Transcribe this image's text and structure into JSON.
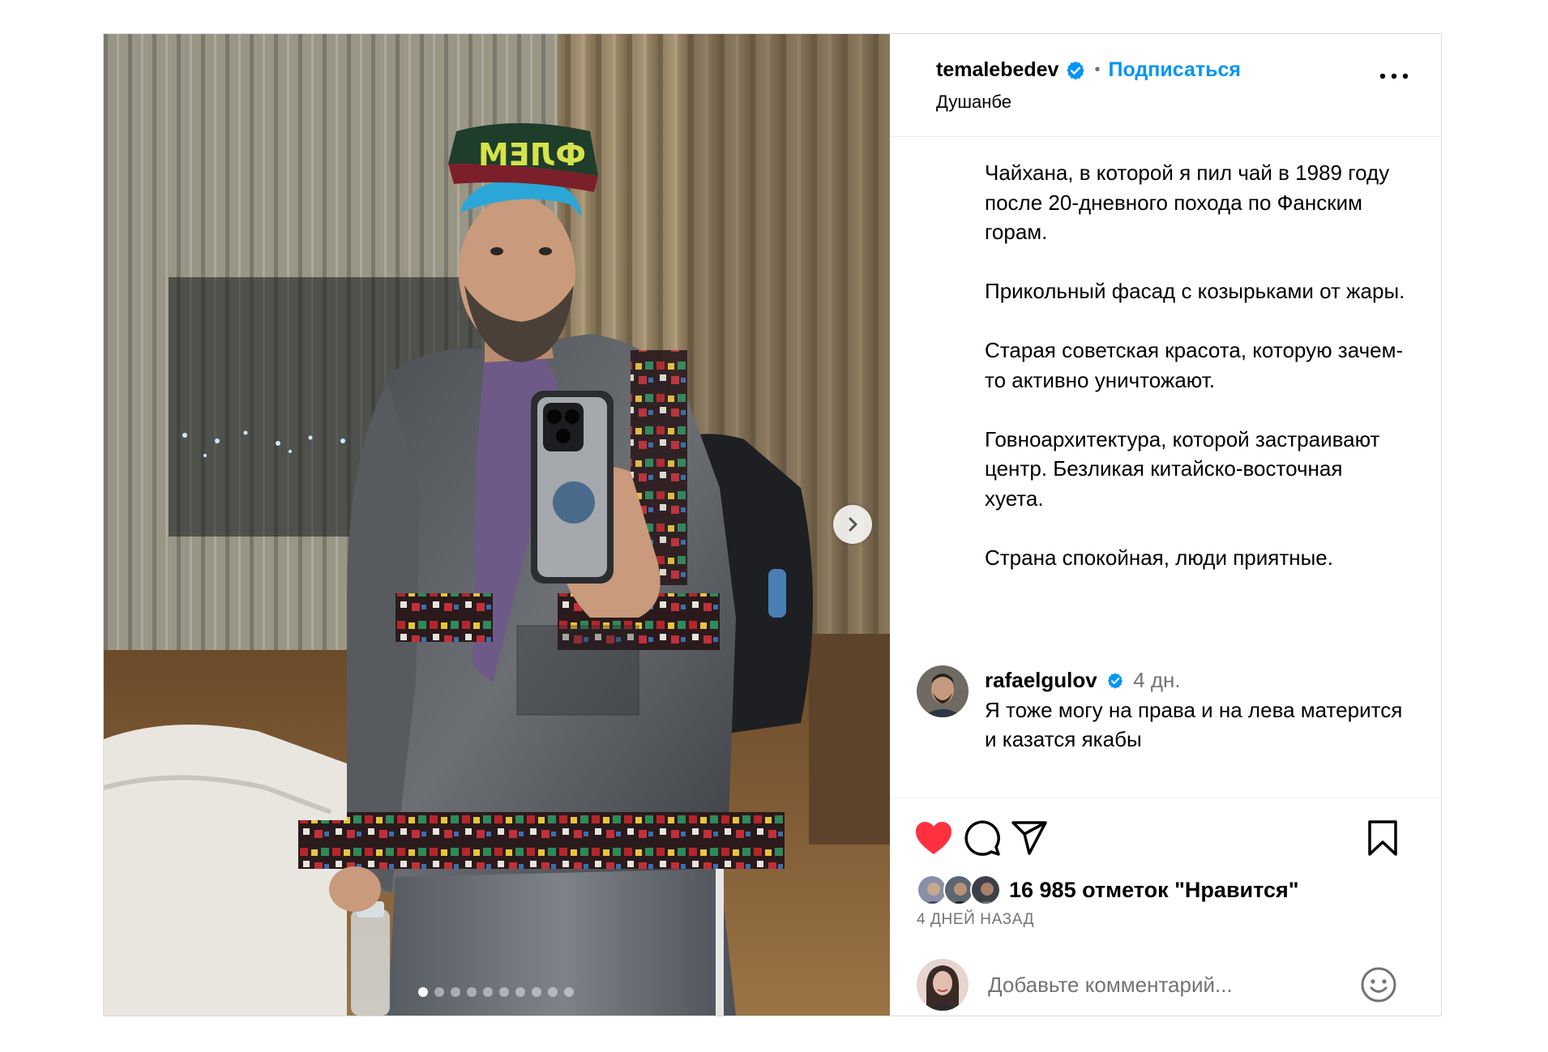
{
  "post": {
    "username": "temalebedev",
    "verified": true,
    "separator": "•",
    "follow_label": "Подписаться",
    "location": "Душанбе",
    "more_icon": "more-horizontal-icon"
  },
  "media": {
    "carousel_total": 10,
    "carousel_active": 1,
    "hat_text": "ФЛЕМ"
  },
  "caption": {
    "paragraphs": [
      "Чайхана, в которой я пил чай в 1989 году после 20-дневного похода по Фанским горам.",
      "Прикольный фасад с козырьками от жары.",
      "Старая советская красота, которую зачем-то активно уничтожают.",
      "Говноархитектура, которой застраивают центр. Безликая китайско-восточная хуета.",
      "Страна спокойная, люди приятные."
    ]
  },
  "comments": [
    {
      "user": "rafaelgulov",
      "verified": true,
      "time": "4 дн.",
      "text": "Я тоже могу на права и на лева матерится и казатся якабы"
    }
  ],
  "actions": {
    "liked": true,
    "likes_text": "16 985 отметок \"Нравится\"",
    "date": "4 ДНЕЙ НАЗАД"
  },
  "add_comment": {
    "placeholder": "Добавьте комментарий..."
  },
  "colors": {
    "accent": "#0095f6",
    "like_red": "#ff3040",
    "muted": "#737373",
    "border": "#dbdbdb"
  }
}
